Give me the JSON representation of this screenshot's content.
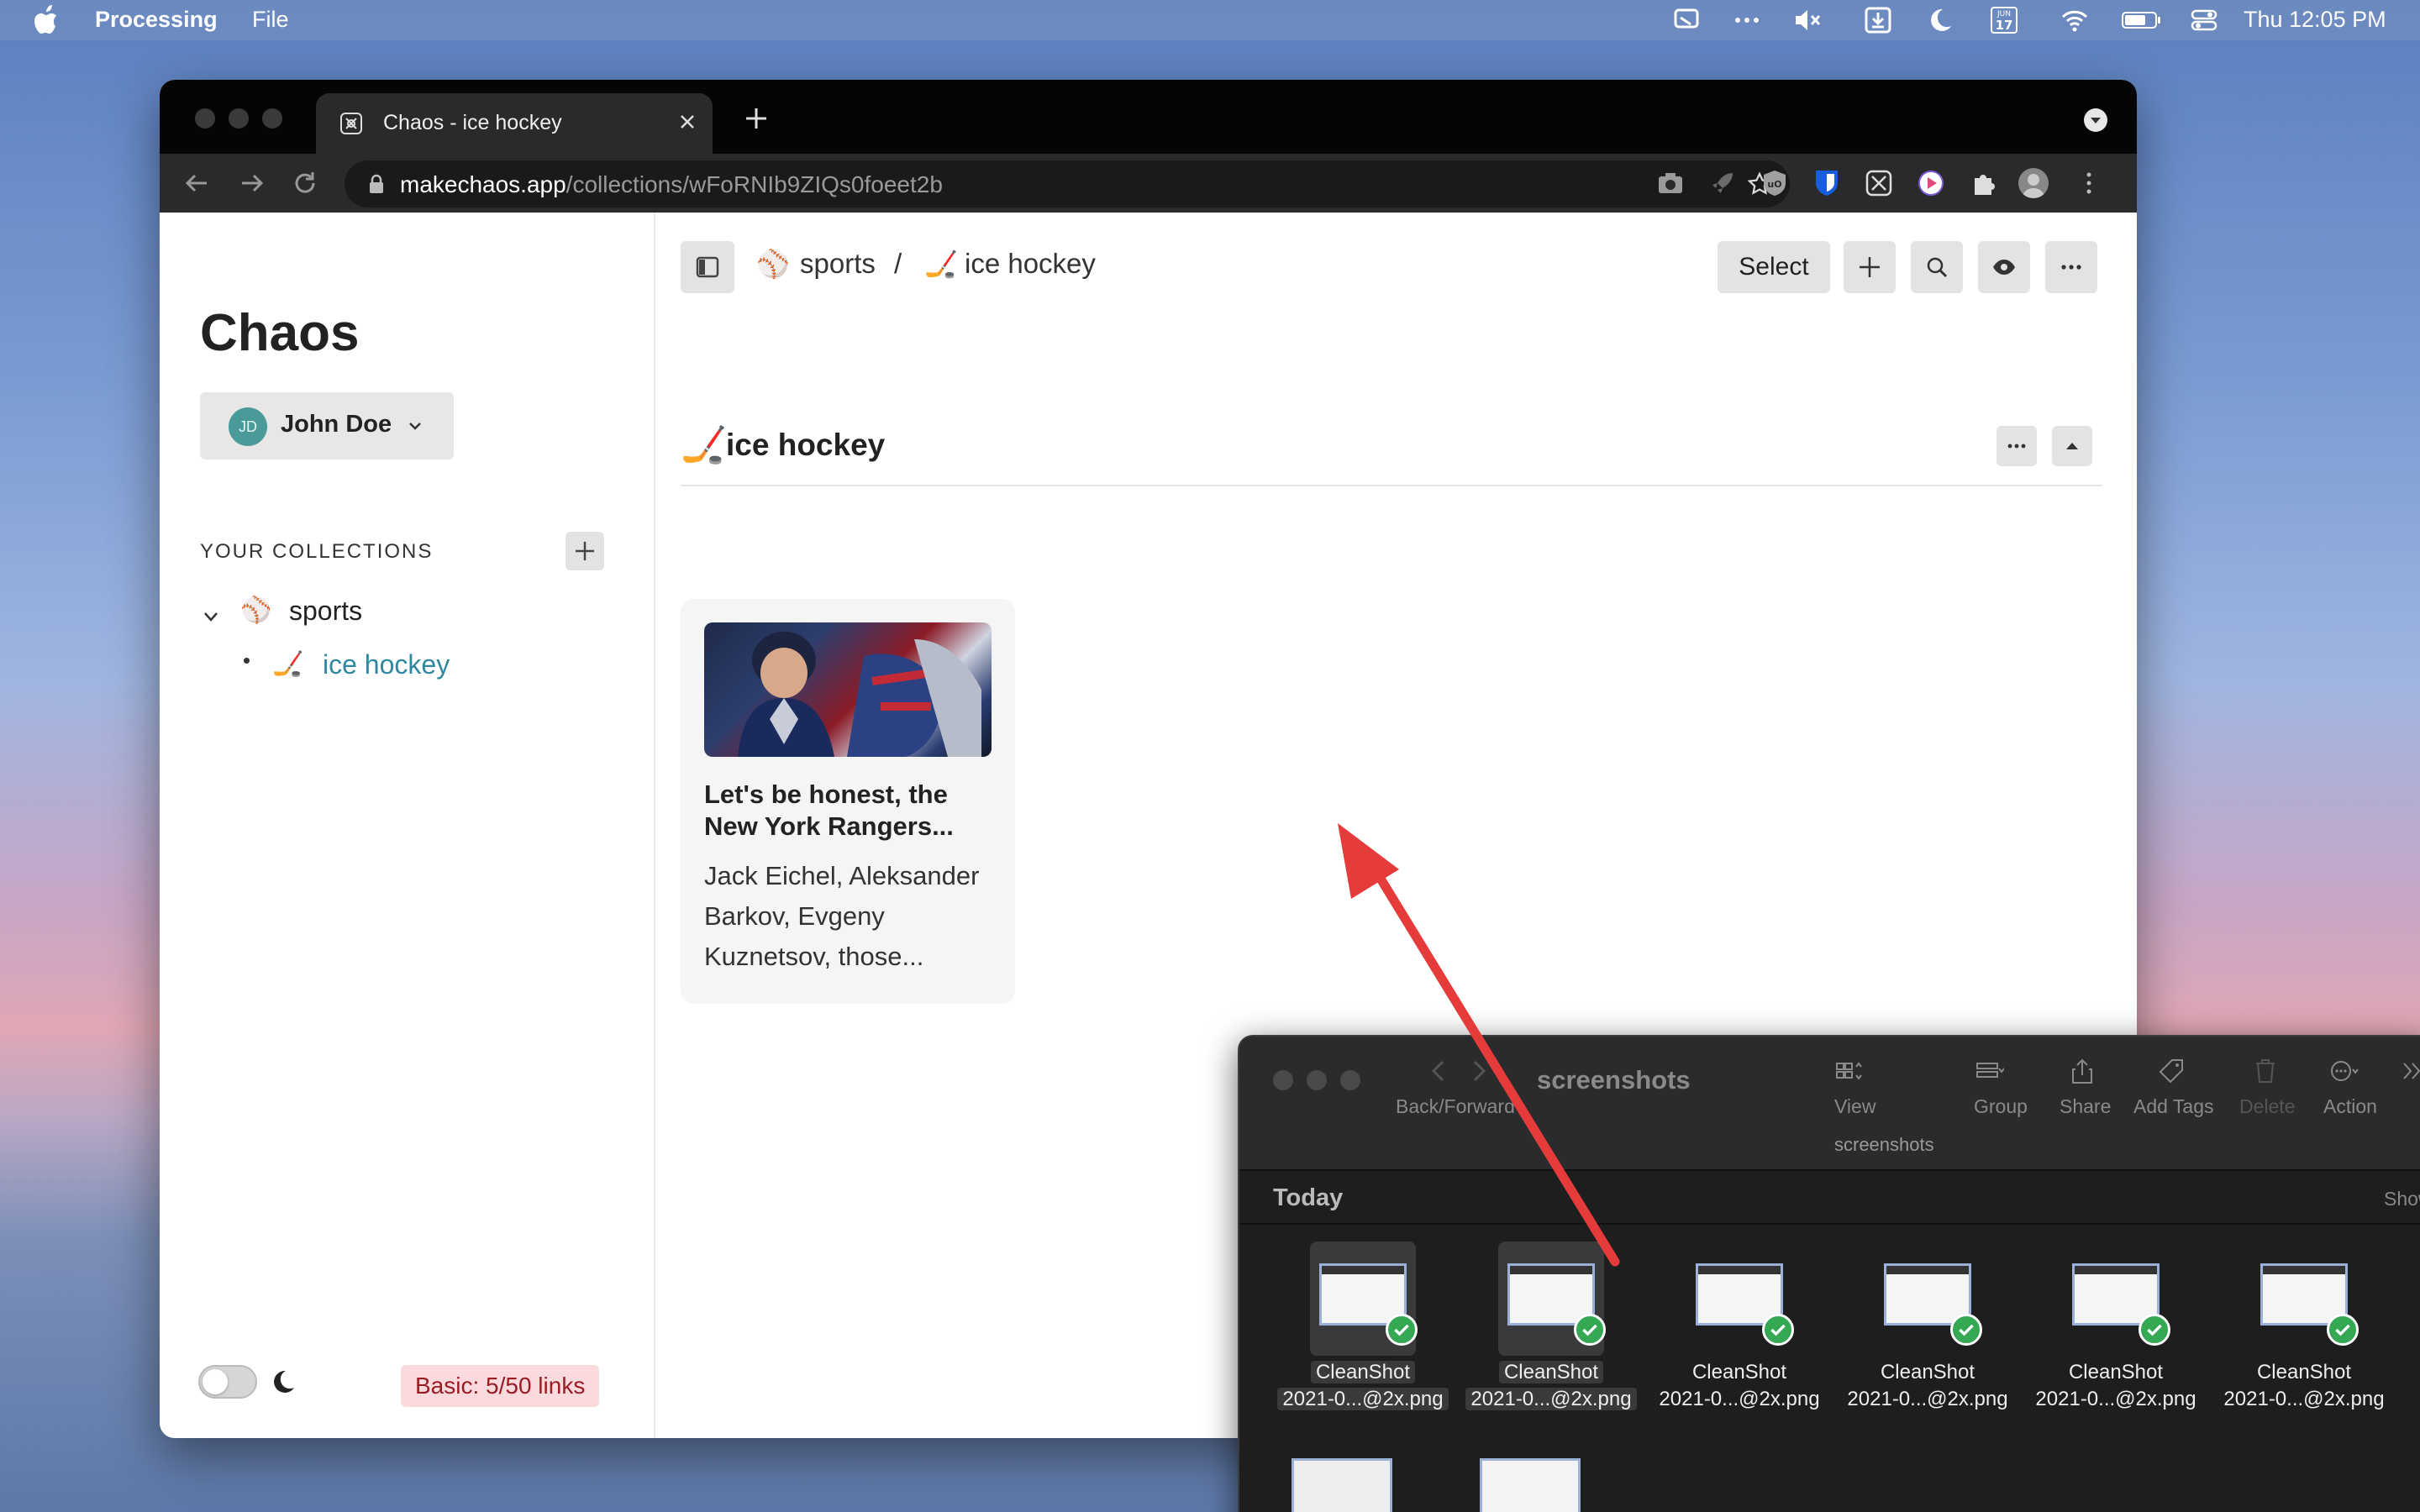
{
  "menubar": {
    "app_name": "Processing",
    "file_menu": "File",
    "clock": "Thu 12:05 PM",
    "calendar_day": "17",
    "calendar_month": "JUN"
  },
  "browser": {
    "tab_title": "Chaos - ice hockey",
    "url_host": "makechaos.app",
    "url_path": "/collections/wFoRNIb9ZIQs0foeet2b"
  },
  "sidebar": {
    "app_title": "Chaos",
    "user_initials": "JD",
    "user_name": "John Doe",
    "collections_heading": "YOUR COLLECTIONS",
    "tree": [
      {
        "emoji": "⚾",
        "label": "sports"
      },
      {
        "emoji": "🏒",
        "label": "ice hockey"
      }
    ],
    "plan_badge": "Basic: 5/50 links"
  },
  "main": {
    "breadcrumbs": [
      {
        "emoji": "⚾",
        "label": "sports"
      },
      {
        "label": "/"
      },
      {
        "emoji": "🏒",
        "label": "ice hockey"
      }
    ],
    "select_label": "Select",
    "section": {
      "emoji": "🏒",
      "title": "ice hockey"
    },
    "card": {
      "title": "Let's be honest, the New York Rangers...",
      "body": "Jack Eichel, Aleksander Barkov, Evgeny Kuznetsov, those..."
    }
  },
  "finder": {
    "title": "screenshots",
    "back_forward_label": "Back/Forward",
    "tools": [
      "View",
      "Group",
      "Share",
      "Add Tags",
      "Delete",
      "Action"
    ],
    "path": "screenshots",
    "section": "Today",
    "show_label": "Show",
    "items": [
      {
        "line1": "CleanShot",
        "line2": "2021-0...@2x.png",
        "selected": true
      },
      {
        "line1": "CleanShot",
        "line2": "2021-0...@2x.png",
        "selected": true
      },
      {
        "line1": "CleanShot",
        "line2": "2021-0...@2x.png",
        "selected": false
      },
      {
        "line1": "CleanShot",
        "line2": "2021-0...@2x.png",
        "selected": false
      },
      {
        "line1": "CleanShot",
        "line2": "2021-0...@2x.png",
        "selected": false
      },
      {
        "line1": "CleanShot",
        "line2": "2021-0...@2x.png",
        "selected": false
      }
    ]
  },
  "colors": {
    "accent_link": "#2f87a0",
    "badge_bg": "#fadadd",
    "badge_text": "#9b1c24",
    "arrow": "#e53b3b",
    "check": "#34a853"
  }
}
